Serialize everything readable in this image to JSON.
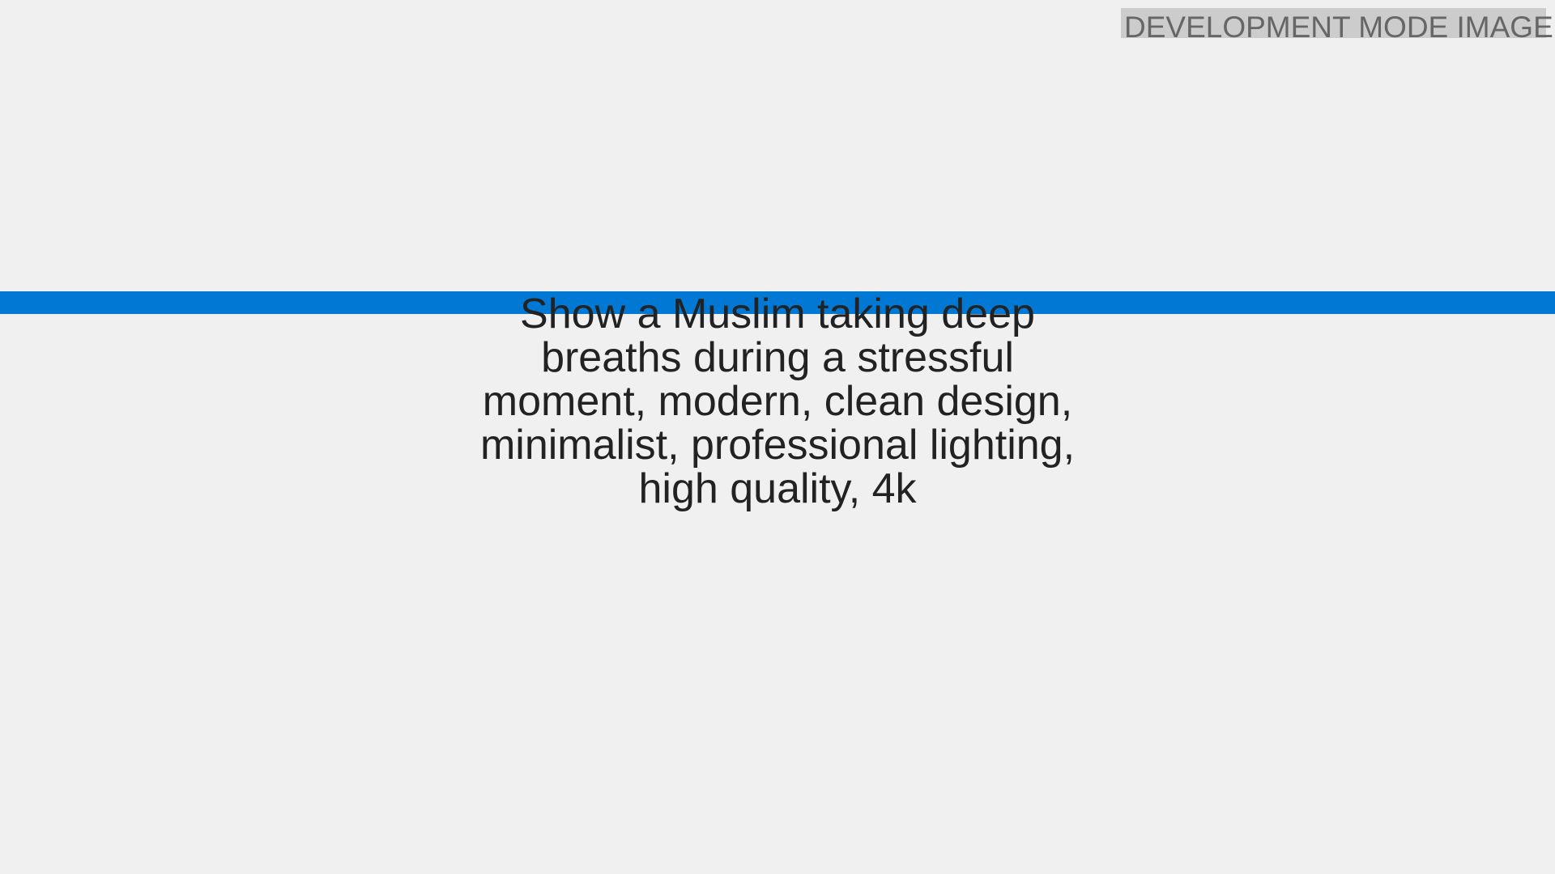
{
  "badge": {
    "label": "DEVELOPMENT MODE IMAGE"
  },
  "prompt": {
    "text": "Show a Muslim taking deep breaths during a stressful moment, modern, clean design, minimalist, professional lighting, high quality, 4k"
  },
  "colors": {
    "background": "#f0f0f0",
    "accent_band": "#0078d4",
    "badge_background": "#cccccc",
    "badge_text": "#666666",
    "prompt_text": "#222222"
  }
}
